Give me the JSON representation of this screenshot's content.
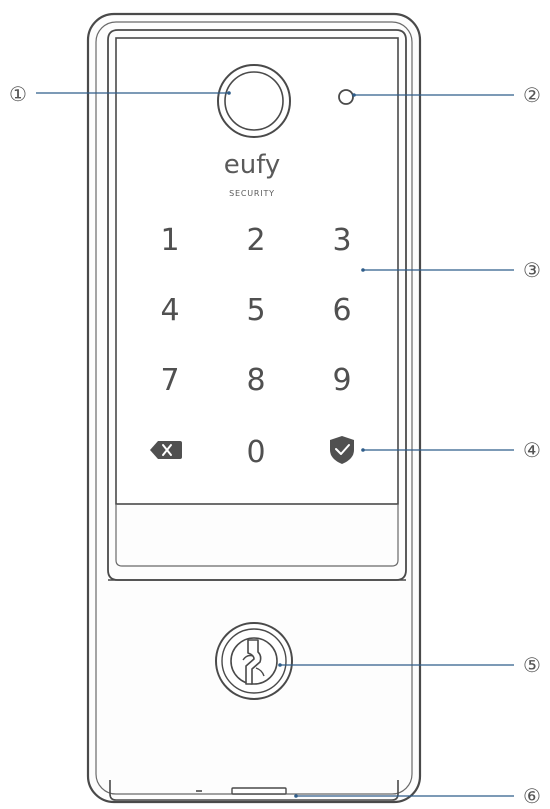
{
  "brand": {
    "logo_text": "eufy",
    "logo_subtext": "SECURITY"
  },
  "keypad": {
    "keys": [
      "1",
      "2",
      "3",
      "4",
      "5",
      "6",
      "7",
      "8",
      "9",
      "0"
    ],
    "backspace_icon": "backspace-icon",
    "lock_icon": "shield-check-icon"
  },
  "callouts": [
    "①",
    "②",
    "③",
    "④",
    "⑤",
    "⑥"
  ],
  "colors": {
    "leader_line": "#2f5d8a",
    "outline": "#4a4a4a"
  }
}
